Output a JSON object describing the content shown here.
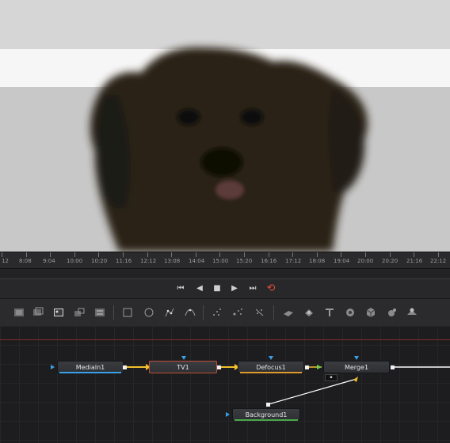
{
  "viewer": {
    "subject": "dog-photo"
  },
  "timeline": {
    "ticks": [
      "12",
      "8:08",
      "9:04",
      "10:00",
      "10:20",
      "11:16",
      "12:12",
      "13:08",
      "14:04",
      "15:00",
      "15:20",
      "16:16",
      "17:12",
      "18:08",
      "19:04",
      "20:00",
      "20:20",
      "21:16",
      "22:12"
    ]
  },
  "transport": {
    "skip_back": "⏮",
    "play_reverse": "◀",
    "stop": "■",
    "play": "▶",
    "skip_forward": "⏭",
    "loop": "⟲"
  },
  "toolbar": {
    "tools": [
      "background-icon",
      "paint-icon",
      "image-icon",
      "text-icon",
      "merge-icon",
      "rectangle-mask-icon",
      "ellipse-mask-icon",
      "polygon-icon",
      "bspline-icon",
      "particles-icon",
      "particle-emitter-icon",
      "particle-render-icon",
      "3d-shape-icon",
      "3d-merge-icon",
      "3d-text-icon",
      "3d-camera-icon",
      "3d-light-icon",
      "3d-render-icon",
      "3d-image-icon"
    ]
  },
  "nodes": {
    "media": "MediaIn1",
    "tv": "TV1",
    "defocus": "Defocus1",
    "merge": "Merge1",
    "background": "Background1"
  },
  "colors": {
    "accent_link": "#f2c12e",
    "selected_border": "#c0503a",
    "port_blue": "#3aa0e8"
  }
}
